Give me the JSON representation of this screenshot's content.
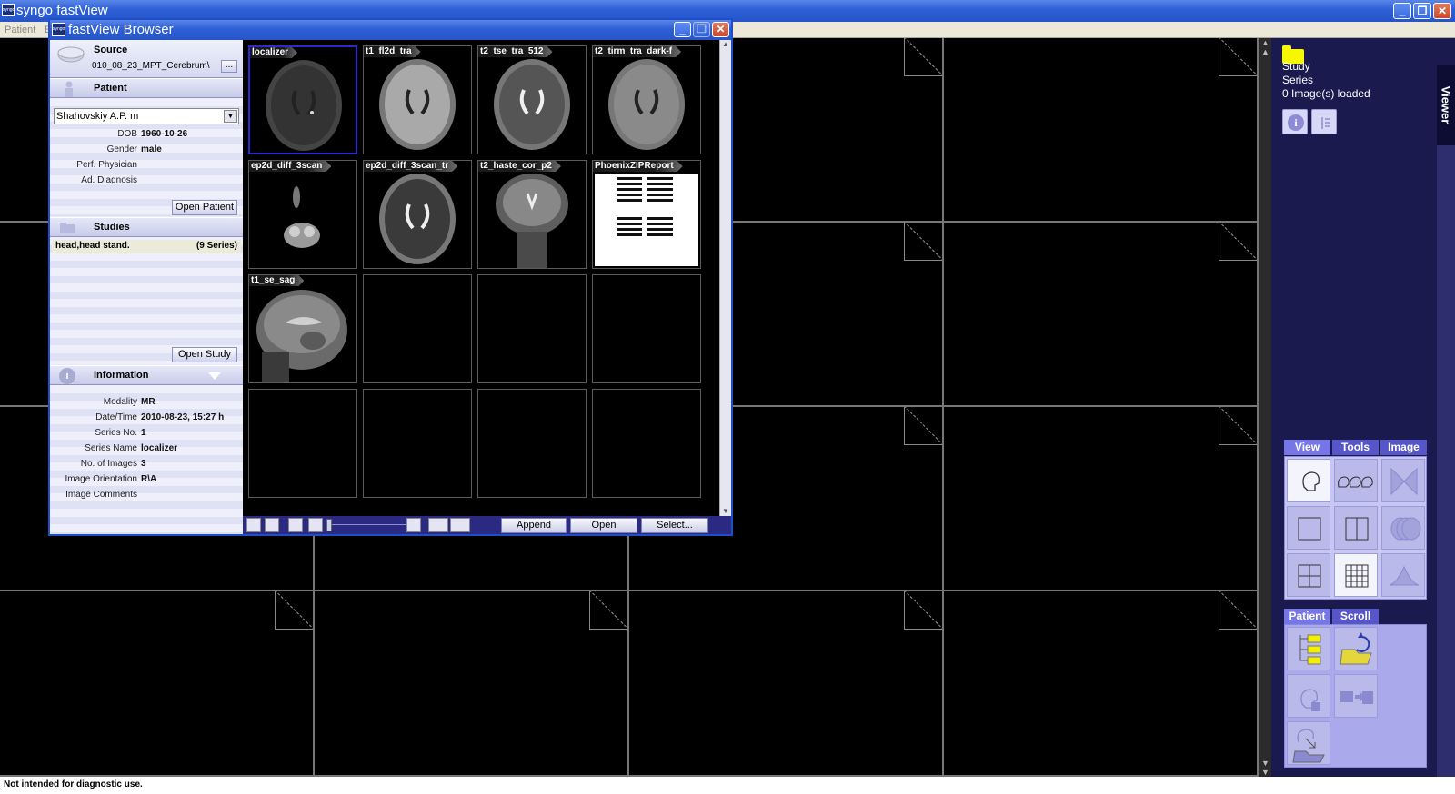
{
  "app": {
    "title": "syngo fastView",
    "logo_text": "syngo"
  },
  "menubar": {
    "items": [
      "Patient",
      "E"
    ]
  },
  "window_buttons": {
    "minimize": "_",
    "maximize": "❐",
    "close": "✕"
  },
  "browser": {
    "title": "fastView Browser",
    "source": {
      "label": "Source",
      "path": "010_08_23_MPT_Cerebrum\\",
      "browse_label": "..."
    },
    "patient": {
      "heading": "Patient",
      "selected": "Shahovskiy A.P. m",
      "fields": [
        {
          "label": "DOB",
          "value": "1960-10-26"
        },
        {
          "label": "Gender",
          "value": "male"
        },
        {
          "label": "Perf. Physician",
          "value": ""
        },
        {
          "label": "Ad. Diagnosis",
          "value": ""
        }
      ],
      "open_button": "Open Patient"
    },
    "studies": {
      "heading": "Studies",
      "items": [
        {
          "name": "head,head stand.",
          "count": "(9 Series)"
        }
      ],
      "open_button": "Open Study"
    },
    "information": {
      "heading": "Information",
      "fields": [
        {
          "label": "Modality",
          "value": "MR"
        },
        {
          "label": "Date/Time",
          "value": "2010-08-23, 15:27 h"
        },
        {
          "label": "Series No.",
          "value": "1"
        },
        {
          "label": "Series Name",
          "value": "localizer"
        },
        {
          "label": "No. of Images",
          "value": "3"
        },
        {
          "label": "Image Orientation",
          "value": "R\\A"
        },
        {
          "label": "Image Comments",
          "value": ""
        }
      ]
    },
    "series": [
      {
        "label": "localizer",
        "kind": "axial-dark",
        "selected": true
      },
      {
        "label": "t1_fl2d_tra",
        "kind": "axial-t1"
      },
      {
        "label": "t2_tse_tra_512",
        "kind": "axial-t2"
      },
      {
        "label": "t2_tirm_tra_dark-f",
        "kind": "axial-flair"
      },
      {
        "label": "ep2d_diff_3scan",
        "kind": "diffusion"
      },
      {
        "label": "ep2d_diff_3scan_tr",
        "kind": "adc"
      },
      {
        "label": "t2_haste_cor_p2",
        "kind": "coronal"
      },
      {
        "label": "PhoenixZIPReport",
        "kind": "report"
      },
      {
        "label": "t1_se_sag",
        "kind": "sagittal"
      }
    ],
    "toolbar": {
      "append": "Append",
      "open": "Open",
      "select": "Select..."
    }
  },
  "panel": {
    "side_tab": "Viewer",
    "study_label": "Study",
    "series_label": "Series",
    "images_loaded": "0 Image(s) loaded",
    "tabs1": [
      "View",
      "Tools",
      "Image"
    ],
    "tabs2": [
      "Patient",
      "Scroll"
    ]
  },
  "status": {
    "text": "Not intended for diagnostic use."
  },
  "colors": {
    "title_blue": "#2d5fd6",
    "panel_dark": "#1a1a4e",
    "tab_active": "#7676e6"
  }
}
